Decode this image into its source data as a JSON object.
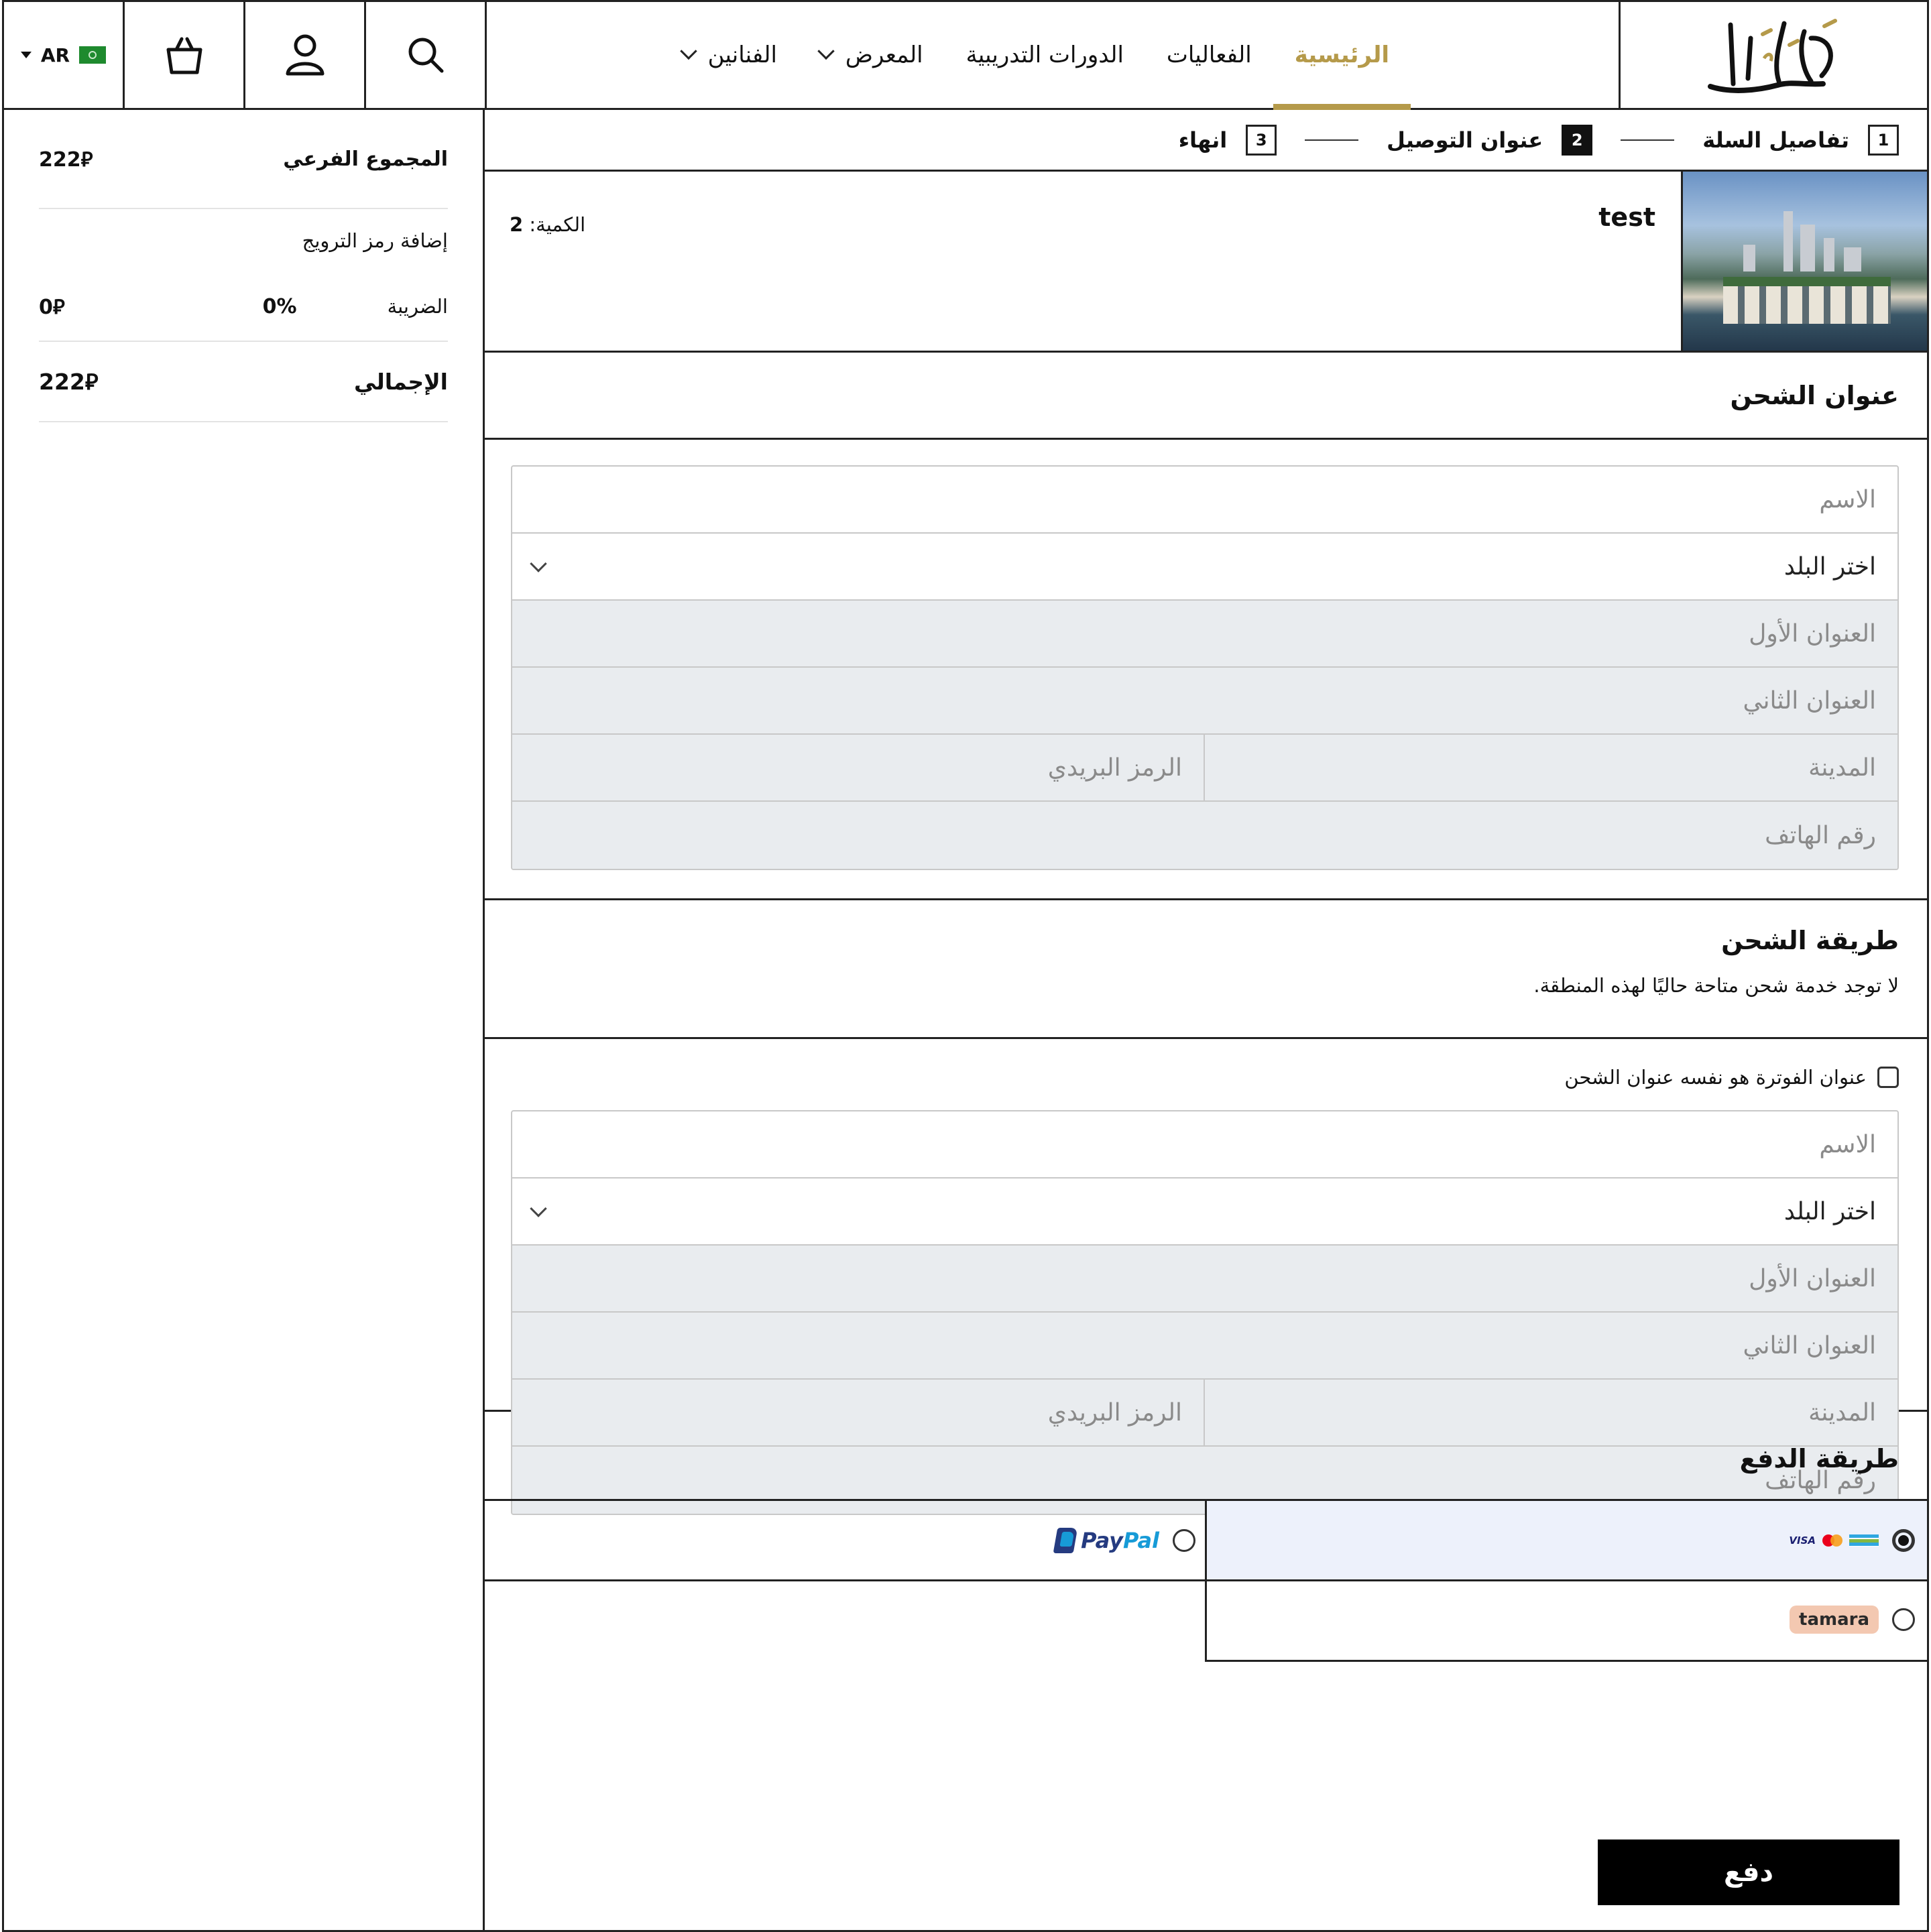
{
  "header": {
    "language": "AR",
    "nav": [
      {
        "label": "الرئيسية",
        "active": true,
        "dropdown": false
      },
      {
        "label": "الفعاليات",
        "active": false,
        "dropdown": false
      },
      {
        "label": "الدورات التدريبية",
        "active": false,
        "dropdown": false
      },
      {
        "label": "المعرض",
        "active": false,
        "dropdown": true
      },
      {
        "label": "الفنانين",
        "active": false,
        "dropdown": true
      }
    ],
    "icons": [
      "search-icon",
      "user-icon",
      "bag-icon",
      "flag-icon"
    ],
    "accent_color": "#b59a4a"
  },
  "steps": [
    {
      "num": "1",
      "label": "تفاصيل السلة",
      "active": false
    },
    {
      "num": "2",
      "label": "عنوان التوصيل",
      "active": true
    },
    {
      "num": "3",
      "label": "انهاء",
      "active": false
    }
  ],
  "cart_item": {
    "name": "test",
    "qty_label": "الكمية:",
    "qty": "2"
  },
  "shipping_address": {
    "title": "عنوان الشحن",
    "name_placeholder": "الاسم",
    "country_placeholder": "اختر البلد",
    "address1_placeholder": "العنوان الأول",
    "address2_placeholder": "العنوان الثاني",
    "city_placeholder": "المدينة",
    "zip_placeholder": "الرمز البريدي",
    "phone_placeholder": "رقم الهاتف"
  },
  "shipping_method": {
    "title": "طريقة الشحن",
    "note": "لا توجد خدمة شحن متاحة حاليًا لهذه المنطقة."
  },
  "billing": {
    "same_as_shipping_label": "عنوان الفوترة هو نفسه عنوان الشحن",
    "name_placeholder": "الاسم",
    "country_placeholder": "اختر البلد",
    "address1_placeholder": "العنوان الأول",
    "address2_placeholder": "العنوان الثاني",
    "city_placeholder": "المدينة",
    "zip_placeholder": "الرمز البريدي",
    "phone_placeholder": "رقم الهاتف"
  },
  "payment": {
    "title": "طريقة الدفع",
    "options": [
      {
        "id": "card",
        "selected": true,
        "logos": "VISA"
      },
      {
        "id": "paypal",
        "selected": false,
        "logo_a": "Pay",
        "logo_b": "Pal"
      },
      {
        "id": "tamara",
        "selected": false,
        "logo": "tamara"
      }
    ],
    "pay_button": "دفع"
  },
  "summary": {
    "subtotal_label": "المجموع الفرعي",
    "subtotal": "222⃁",
    "promo_label": "إضافة رمز الترويج",
    "tax_label": "الضريبة",
    "tax_percent": "0%",
    "tax_value": "0⃁",
    "total_label": "الإجمالي",
    "total": "222⃁"
  }
}
